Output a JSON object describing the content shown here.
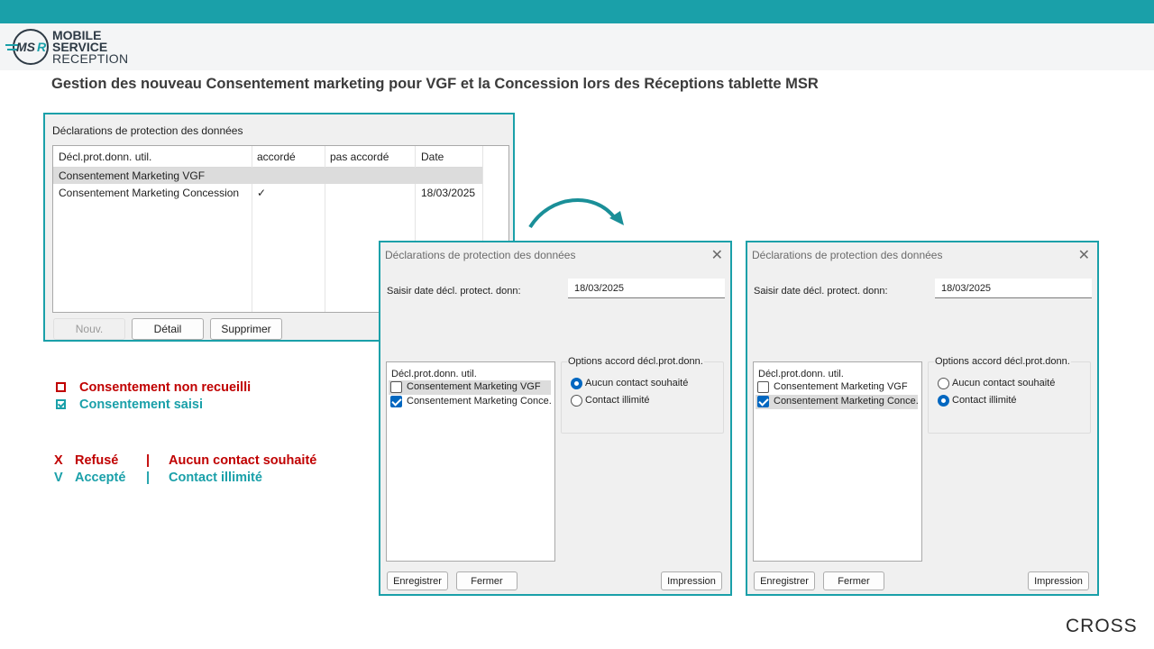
{
  "brand": {
    "line1": "MOBILE",
    "line2": "SERVICE",
    "line3": "RECEPTION",
    "mark": "MSR",
    "accent": "#1aa0a9"
  },
  "headline": "Gestion des nouveau Consentement marketing pour VGF et la Concession lors des Réceptions tablette MSR",
  "main_window": {
    "group_title": "Déclarations de protection des données",
    "columns": [
      "Décl.prot.donn. util.",
      "accordé",
      "pas accordé",
      "Date"
    ],
    "rows": [
      {
        "name": "Consentement Marketing VGF",
        "accorde": "",
        "pas_accorde": "",
        "date": ""
      },
      {
        "name": "Consentement Marketing Concession",
        "accorde": "✓",
        "pas_accorde": "",
        "date": "18/03/2025"
      }
    ],
    "buttons": {
      "new": "Nouv.",
      "detail": "Détail",
      "delete": "Supprimer"
    }
  },
  "dialog_left": {
    "title": "Déclarations de protection des données",
    "date_label": "Saisir date décl. protect. donn:",
    "date_value": "18/03/2025",
    "list_header": "Décl.prot.donn. util.",
    "items": [
      {
        "label": "Consentement Marketing VGF",
        "checked": false
      },
      {
        "label": "Consentement Marketing Conce...",
        "checked": true
      }
    ],
    "options_title": "Options accord décl.prot.donn.",
    "options": [
      {
        "label": "Aucun contact souhaité",
        "selected": true
      },
      {
        "label": "Contact illimité",
        "selected": false
      }
    ],
    "buttons": {
      "save": "Enregistrer",
      "close": "Fermer",
      "print": "Impression"
    }
  },
  "dialog_right": {
    "title": "Déclarations de protection des données",
    "date_label": "Saisir date décl. protect. donn:",
    "date_value": "18/03/2025",
    "list_header": "Décl.prot.donn. util.",
    "items": [
      {
        "label": "Consentement Marketing VGF",
        "checked": false
      },
      {
        "label": "Consentement Marketing Conce...",
        "checked": true
      }
    ],
    "options_title": "Options accord décl.prot.donn.",
    "options": [
      {
        "label": "Aucun contact souhaité",
        "selected": false
      },
      {
        "label": "Contact illimité",
        "selected": true
      }
    ],
    "buttons": {
      "save": "Enregistrer",
      "close": "Fermer",
      "print": "Impression"
    }
  },
  "legend": {
    "not_collected": "Consentement non recueilli",
    "entered": "Consentement saisi",
    "refused_letter": "X",
    "refused": "Refusé",
    "refused_meaning": "Aucun contact souhaité",
    "accepted_letter": "V",
    "accepted": "Accepté",
    "accepted_meaning": "Contact illimité",
    "separator": "|",
    "colors": {
      "negative": "#c00000",
      "positive": "#1aa0a9"
    }
  },
  "footer_logo": "CROSS"
}
